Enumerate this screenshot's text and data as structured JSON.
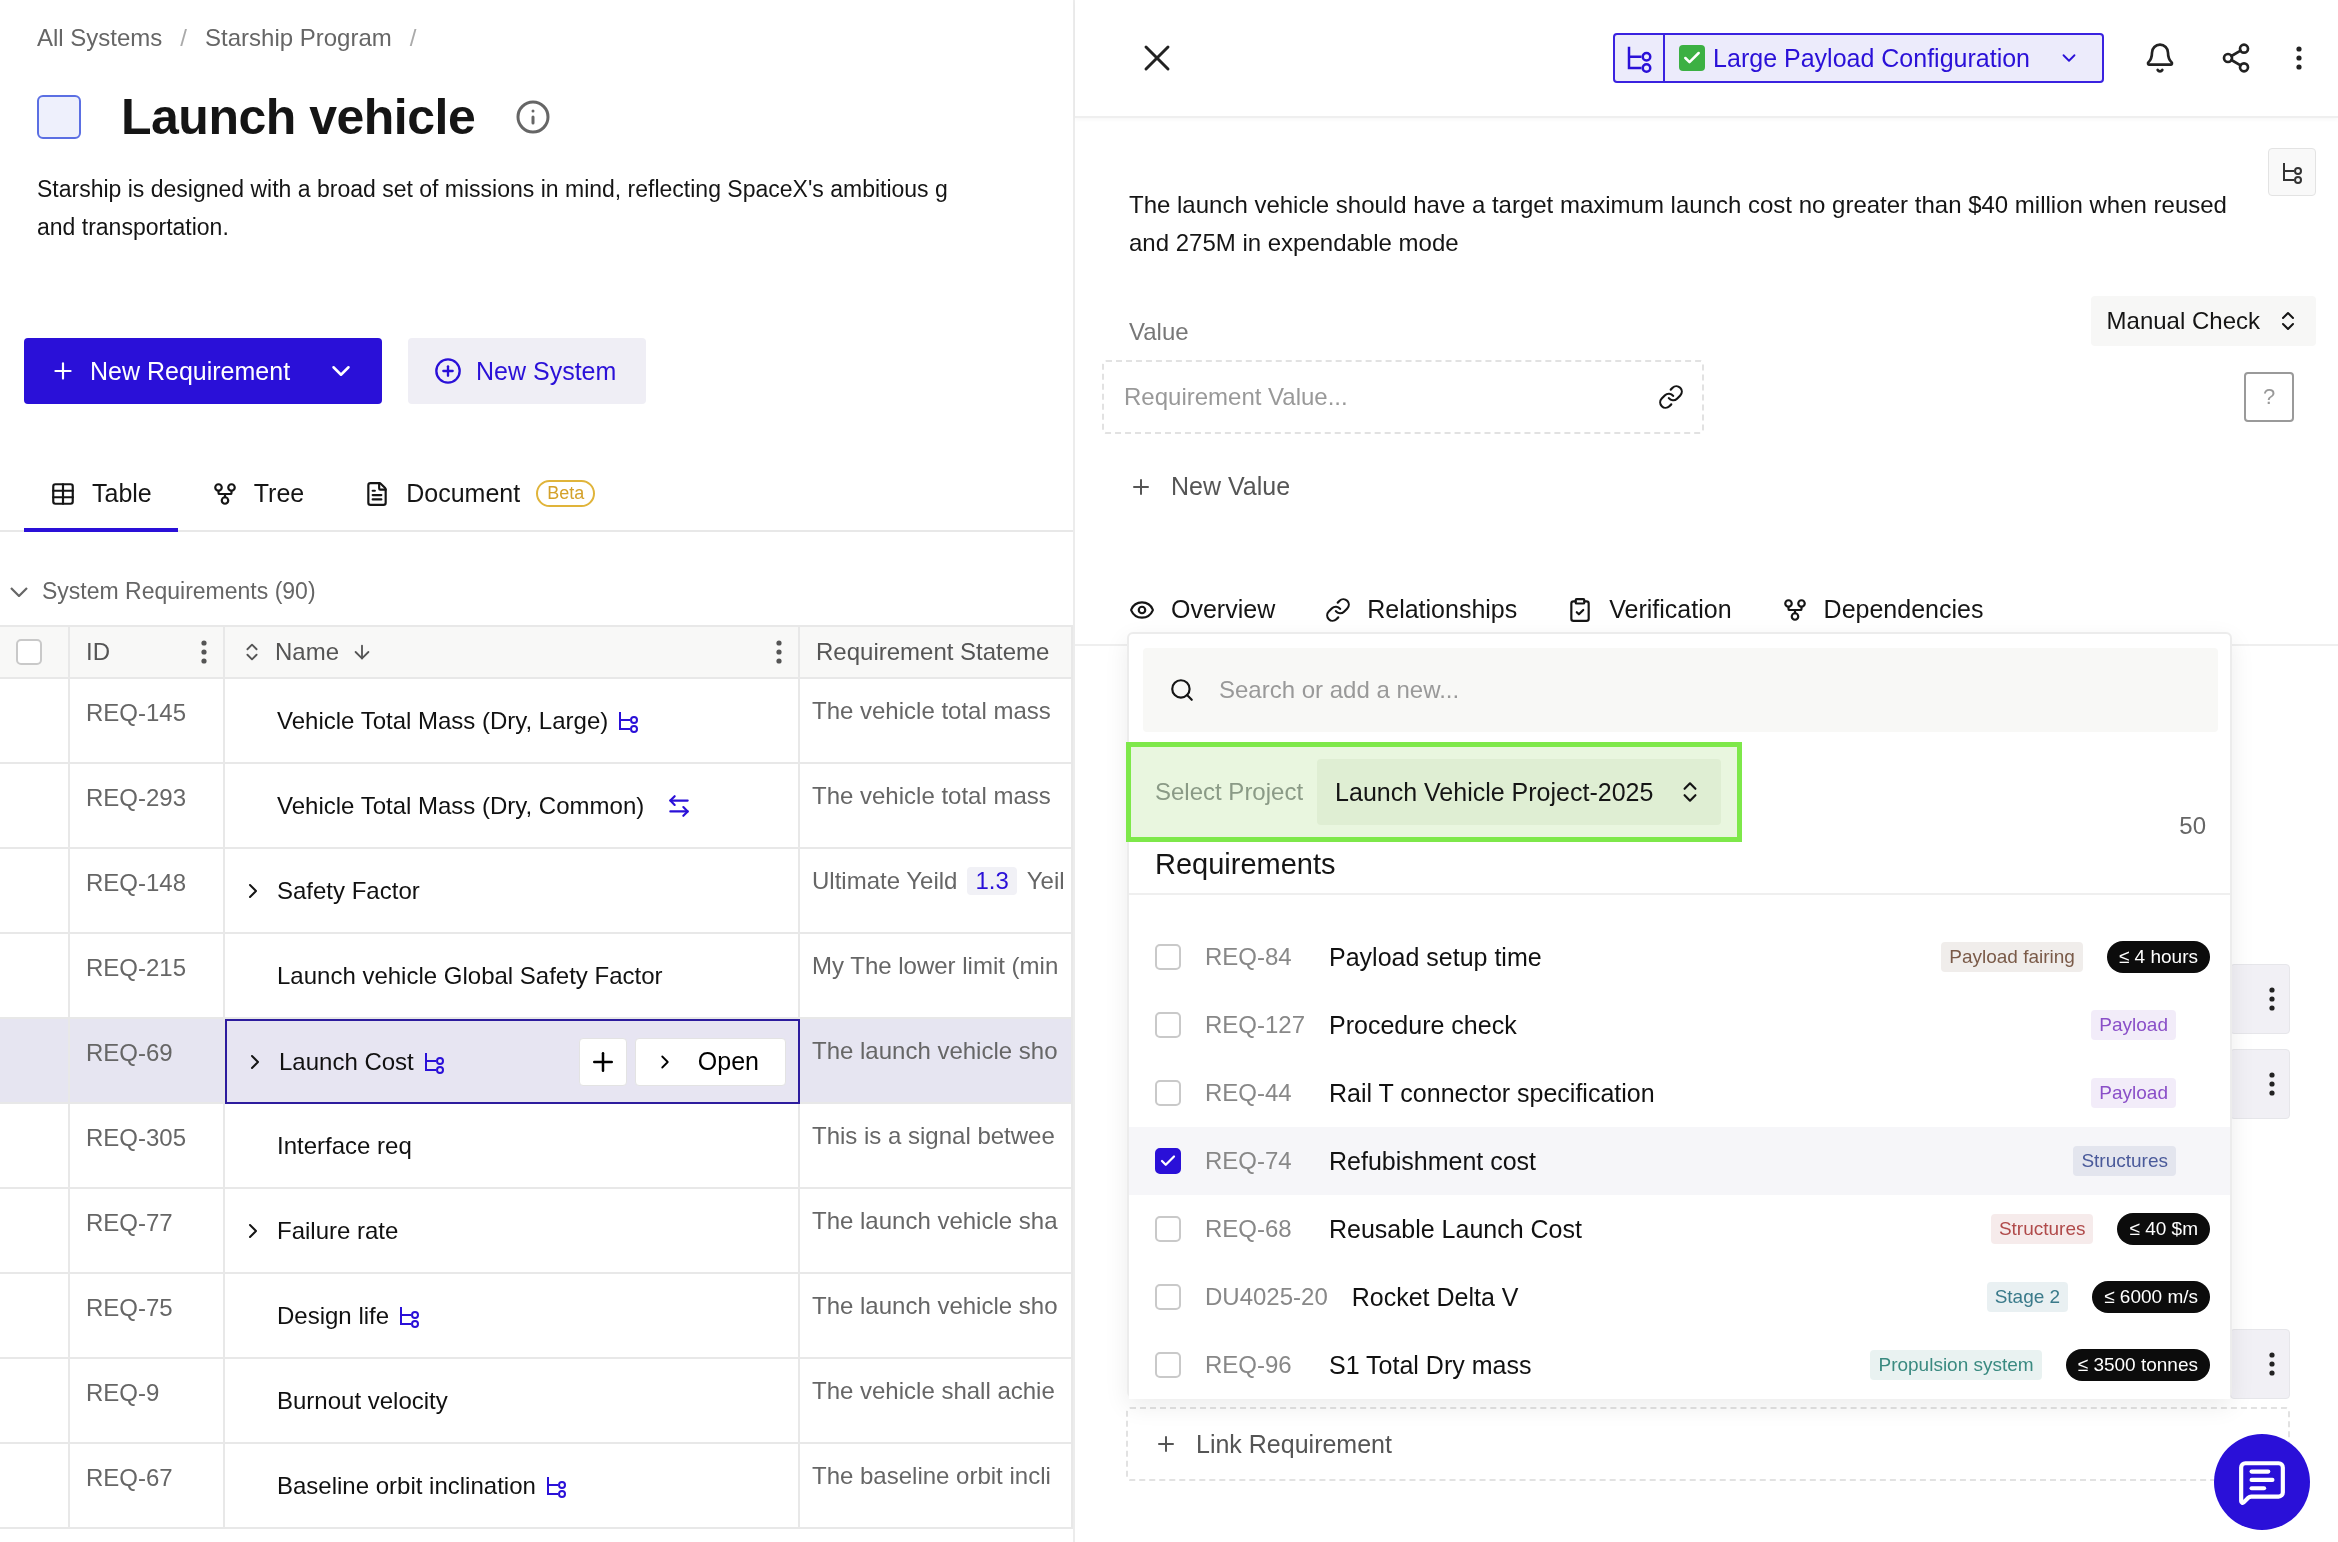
{
  "breadcrumb": {
    "items": [
      "All Systems",
      "Starship Program"
    ],
    "separator": "/"
  },
  "page": {
    "title": "Launch vehicle",
    "description_lines": [
      "Starship is designed with a broad set of missions in mind, reflecting SpaceX's ambitious g",
      "and transportation."
    ]
  },
  "actions": {
    "primary": "New Requirement",
    "secondary": "New System"
  },
  "view_tabs": [
    {
      "label": "Table",
      "kind": "table",
      "selected": true
    },
    {
      "label": "Tree",
      "kind": "tree",
      "selected": false
    },
    {
      "label": "Document",
      "kind": "document",
      "selected": false,
      "badge": "Beta"
    }
  ],
  "section": {
    "title": "System Requirements (90)",
    "expanded": true
  },
  "table": {
    "select_all": {
      "checked": false
    },
    "columns": [
      "ID",
      "Name",
      "Requirement Stateme"
    ],
    "rows": [
      {
        "id": "REQ-145",
        "name": "Vehicle Total Mass (Dry, Large)",
        "kind": "variant",
        "expandable": false,
        "selected": false,
        "statement": "The vehicle total mass"
      },
      {
        "id": "REQ-293",
        "name": "Vehicle Total Mass (Dry, Common)",
        "kind": "linked",
        "expandable": false,
        "selected": false,
        "statement": "The vehicle total mass"
      },
      {
        "id": "REQ-148",
        "name": "Safety Factor",
        "expandable": true,
        "selected": false,
        "statement": "Ultimate Yeild",
        "chip": "1.3",
        "statement_end": "Yeil"
      },
      {
        "id": "REQ-215",
        "name": "Launch vehicle Global Safety Factor",
        "expandable": false,
        "selected": false,
        "statement": "My The lower limit (min"
      },
      {
        "id": "REQ-69",
        "name": "Launch Cost",
        "kind": "variant",
        "expandable": true,
        "selected": true,
        "open_label": "Open",
        "statement": "The launch vehicle sho"
      },
      {
        "id": "REQ-305",
        "name": "Interface req",
        "expandable": false,
        "selected": false,
        "statement": "This is a signal betwee"
      },
      {
        "id": "REQ-77",
        "name": "Failure rate",
        "expandable": true,
        "selected": false,
        "statement": "The launch vehicle sha"
      },
      {
        "id": "REQ-75",
        "name": "Design life",
        "kind": "variant",
        "expandable": false,
        "selected": false,
        "statement": "The launch vehicle sho"
      },
      {
        "id": "REQ-9",
        "name": "Burnout velocity",
        "expandable": false,
        "selected": false,
        "statement": "The vehicle shall achie"
      },
      {
        "id": "REQ-67",
        "name": "Baseline orbit inclination",
        "kind": "variant",
        "expandable": false,
        "selected": false,
        "statement": "The baseline orbit incli"
      }
    ]
  },
  "detail": {
    "config": {
      "label": "Large Payload Configuration",
      "verified": true
    },
    "statement": "The launch vehicle should have a target maximum launch cost no greater than $40 million when reused and 275M in expendable mode",
    "value_label": "Value",
    "value_placeholder": "Requirement Value...",
    "check_method": "Manual Check",
    "help": "?",
    "new_value": "New Value",
    "tabs": [
      {
        "label": "Overview",
        "kind": "overview"
      },
      {
        "label": "Relationships",
        "kind": "relationships"
      },
      {
        "label": "Verification",
        "kind": "verification"
      },
      {
        "label": "Dependencies",
        "kind": "dependencies"
      }
    ],
    "link_requirement": "Link Requirement"
  },
  "picker": {
    "search_placeholder": "Search or add a new...",
    "project_label": "Select Project",
    "project": "Launch Vehicle Project-2025",
    "highlighted": true,
    "count": "50",
    "heading": "Requirements",
    "items": [
      {
        "id": "REQ-84",
        "name": "Payload setup time",
        "checked": false,
        "tag": {
          "label": "Payload fairing",
          "color": "#7a5a48"
        },
        "limit": "≤ 4 hours"
      },
      {
        "id": "REQ-127",
        "name": "Procedure check",
        "checked": false,
        "tag": {
          "label": "Payload",
          "color": "#8a4fc8"
        }
      },
      {
        "id": "REQ-44",
        "name": "Rail T connector specification",
        "checked": false,
        "tag": {
          "label": "Payload",
          "color": "#8a4fc8"
        }
      },
      {
        "id": "REQ-74",
        "name": "Refubishment cost",
        "checked": true,
        "tag": {
          "label": "Structures",
          "color": "#4a5a9a"
        }
      },
      {
        "id": "REQ-68",
        "name": "Reusable Launch Cost",
        "checked": false,
        "tag": {
          "label": "Structures",
          "color": "#b04a4a"
        },
        "limit": "≤ 40 $m"
      },
      {
        "id": "DU4025-20",
        "name": "Rocket Delta V",
        "checked": false,
        "tag": {
          "label": "Stage 2",
          "color": "#3a7a8a"
        },
        "limit": "≤ 6000 m/s"
      },
      {
        "id": "REQ-96",
        "name": "S1 Total Dry mass",
        "checked": false,
        "tag": {
          "label": "Propulsion system",
          "color": "#3a8a80"
        },
        "limit": "≤ 3500 tonnes"
      }
    ]
  }
}
